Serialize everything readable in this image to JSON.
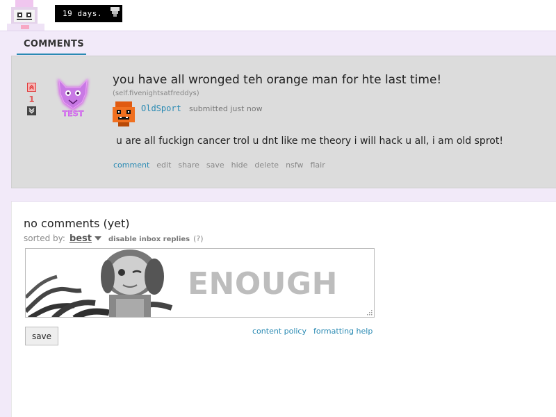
{
  "header": {
    "countdown_text": "19 days."
  },
  "tabs": [
    {
      "label": "COMMENTS",
      "active": true
    }
  ],
  "post": {
    "score": "1",
    "title": "you have all wronged teh orange man for hte last time!",
    "domain": "(self.fivenightsatfreddys)",
    "author": "OldSport",
    "submitted": "submitted just now",
    "selftext": "u are all fuckign cancer trol u dnt like me theory i will hack u all, i am old sprot!",
    "thumbnail_text": "TEST",
    "actions": [
      "comment",
      "edit",
      "share",
      "save",
      "hide",
      "delete",
      "nsfw",
      "flair"
    ]
  },
  "comments": {
    "heading": "no comments (yet)",
    "sort_label": "sorted by:",
    "sort_value": "best",
    "disable_inbox": "disable inbox replies",
    "help": "(?)",
    "comment_box_text": "ENOUGH",
    "save_label": "save",
    "links": [
      "content policy",
      "formatting help"
    ]
  },
  "colors": {
    "accent": "#2a8ab3",
    "page_background": "#f2eaf9",
    "post_panel": "#dcdcdc",
    "upvote": "#e03a3a"
  }
}
